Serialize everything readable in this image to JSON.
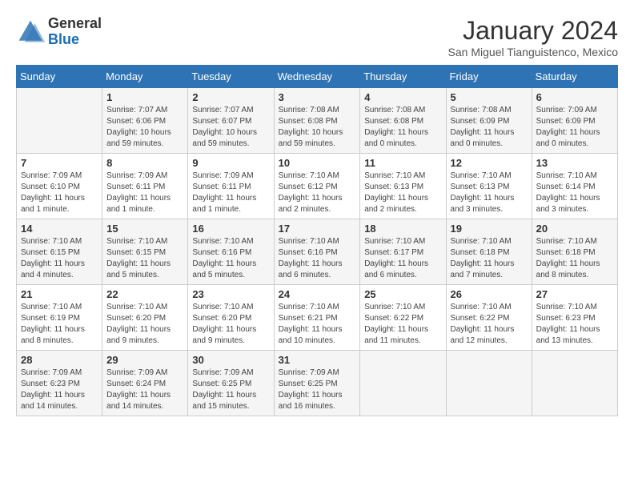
{
  "header": {
    "logo_general": "General",
    "logo_blue": "Blue",
    "month_title": "January 2024",
    "location": "San Miguel Tianguistenco, Mexico"
  },
  "calendar": {
    "days_of_week": [
      "Sunday",
      "Monday",
      "Tuesday",
      "Wednesday",
      "Thursday",
      "Friday",
      "Saturday"
    ],
    "weeks": [
      [
        {
          "day": "",
          "sunrise": "",
          "sunset": "",
          "daylight": ""
        },
        {
          "day": "1",
          "sunrise": "Sunrise: 7:07 AM",
          "sunset": "Sunset: 6:06 PM",
          "daylight": "Daylight: 10 hours and 59 minutes."
        },
        {
          "day": "2",
          "sunrise": "Sunrise: 7:07 AM",
          "sunset": "Sunset: 6:07 PM",
          "daylight": "Daylight: 10 hours and 59 minutes."
        },
        {
          "day": "3",
          "sunrise": "Sunrise: 7:08 AM",
          "sunset": "Sunset: 6:08 PM",
          "daylight": "Daylight: 10 hours and 59 minutes."
        },
        {
          "day": "4",
          "sunrise": "Sunrise: 7:08 AM",
          "sunset": "Sunset: 6:08 PM",
          "daylight": "Daylight: 11 hours and 0 minutes."
        },
        {
          "day": "5",
          "sunrise": "Sunrise: 7:08 AM",
          "sunset": "Sunset: 6:09 PM",
          "daylight": "Daylight: 11 hours and 0 minutes."
        },
        {
          "day": "6",
          "sunrise": "Sunrise: 7:09 AM",
          "sunset": "Sunset: 6:09 PM",
          "daylight": "Daylight: 11 hours and 0 minutes."
        }
      ],
      [
        {
          "day": "7",
          "sunrise": "Sunrise: 7:09 AM",
          "sunset": "Sunset: 6:10 PM",
          "daylight": "Daylight: 11 hours and 1 minute."
        },
        {
          "day": "8",
          "sunrise": "Sunrise: 7:09 AM",
          "sunset": "Sunset: 6:11 PM",
          "daylight": "Daylight: 11 hours and 1 minute."
        },
        {
          "day": "9",
          "sunrise": "Sunrise: 7:09 AM",
          "sunset": "Sunset: 6:11 PM",
          "daylight": "Daylight: 11 hours and 1 minute."
        },
        {
          "day": "10",
          "sunrise": "Sunrise: 7:10 AM",
          "sunset": "Sunset: 6:12 PM",
          "daylight": "Daylight: 11 hours and 2 minutes."
        },
        {
          "day": "11",
          "sunrise": "Sunrise: 7:10 AM",
          "sunset": "Sunset: 6:13 PM",
          "daylight": "Daylight: 11 hours and 2 minutes."
        },
        {
          "day": "12",
          "sunrise": "Sunrise: 7:10 AM",
          "sunset": "Sunset: 6:13 PM",
          "daylight": "Daylight: 11 hours and 3 minutes."
        },
        {
          "day": "13",
          "sunrise": "Sunrise: 7:10 AM",
          "sunset": "Sunset: 6:14 PM",
          "daylight": "Daylight: 11 hours and 3 minutes."
        }
      ],
      [
        {
          "day": "14",
          "sunrise": "Sunrise: 7:10 AM",
          "sunset": "Sunset: 6:15 PM",
          "daylight": "Daylight: 11 hours and 4 minutes."
        },
        {
          "day": "15",
          "sunrise": "Sunrise: 7:10 AM",
          "sunset": "Sunset: 6:15 PM",
          "daylight": "Daylight: 11 hours and 5 minutes."
        },
        {
          "day": "16",
          "sunrise": "Sunrise: 7:10 AM",
          "sunset": "Sunset: 6:16 PM",
          "daylight": "Daylight: 11 hours and 5 minutes."
        },
        {
          "day": "17",
          "sunrise": "Sunrise: 7:10 AM",
          "sunset": "Sunset: 6:16 PM",
          "daylight": "Daylight: 11 hours and 6 minutes."
        },
        {
          "day": "18",
          "sunrise": "Sunrise: 7:10 AM",
          "sunset": "Sunset: 6:17 PM",
          "daylight": "Daylight: 11 hours and 6 minutes."
        },
        {
          "day": "19",
          "sunrise": "Sunrise: 7:10 AM",
          "sunset": "Sunset: 6:18 PM",
          "daylight": "Daylight: 11 hours and 7 minutes."
        },
        {
          "day": "20",
          "sunrise": "Sunrise: 7:10 AM",
          "sunset": "Sunset: 6:18 PM",
          "daylight": "Daylight: 11 hours and 8 minutes."
        }
      ],
      [
        {
          "day": "21",
          "sunrise": "Sunrise: 7:10 AM",
          "sunset": "Sunset: 6:19 PM",
          "daylight": "Daylight: 11 hours and 8 minutes."
        },
        {
          "day": "22",
          "sunrise": "Sunrise: 7:10 AM",
          "sunset": "Sunset: 6:20 PM",
          "daylight": "Daylight: 11 hours and 9 minutes."
        },
        {
          "day": "23",
          "sunrise": "Sunrise: 7:10 AM",
          "sunset": "Sunset: 6:20 PM",
          "daylight": "Daylight: 11 hours and 9 minutes."
        },
        {
          "day": "24",
          "sunrise": "Sunrise: 7:10 AM",
          "sunset": "Sunset: 6:21 PM",
          "daylight": "Daylight: 11 hours and 10 minutes."
        },
        {
          "day": "25",
          "sunrise": "Sunrise: 7:10 AM",
          "sunset": "Sunset: 6:22 PM",
          "daylight": "Daylight: 11 hours and 11 minutes."
        },
        {
          "day": "26",
          "sunrise": "Sunrise: 7:10 AM",
          "sunset": "Sunset: 6:22 PM",
          "daylight": "Daylight: 11 hours and 12 minutes."
        },
        {
          "day": "27",
          "sunrise": "Sunrise: 7:10 AM",
          "sunset": "Sunset: 6:23 PM",
          "daylight": "Daylight: 11 hours and 13 minutes."
        }
      ],
      [
        {
          "day": "28",
          "sunrise": "Sunrise: 7:09 AM",
          "sunset": "Sunset: 6:23 PM",
          "daylight": "Daylight: 11 hours and 14 minutes."
        },
        {
          "day": "29",
          "sunrise": "Sunrise: 7:09 AM",
          "sunset": "Sunset: 6:24 PM",
          "daylight": "Daylight: 11 hours and 14 minutes."
        },
        {
          "day": "30",
          "sunrise": "Sunrise: 7:09 AM",
          "sunset": "Sunset: 6:25 PM",
          "daylight": "Daylight: 11 hours and 15 minutes."
        },
        {
          "day": "31",
          "sunrise": "Sunrise: 7:09 AM",
          "sunset": "Sunset: 6:25 PM",
          "daylight": "Daylight: 11 hours and 16 minutes."
        },
        {
          "day": "",
          "sunrise": "",
          "sunset": "",
          "daylight": ""
        },
        {
          "day": "",
          "sunrise": "",
          "sunset": "",
          "daylight": ""
        },
        {
          "day": "",
          "sunrise": "",
          "sunset": "",
          "daylight": ""
        }
      ]
    ]
  }
}
